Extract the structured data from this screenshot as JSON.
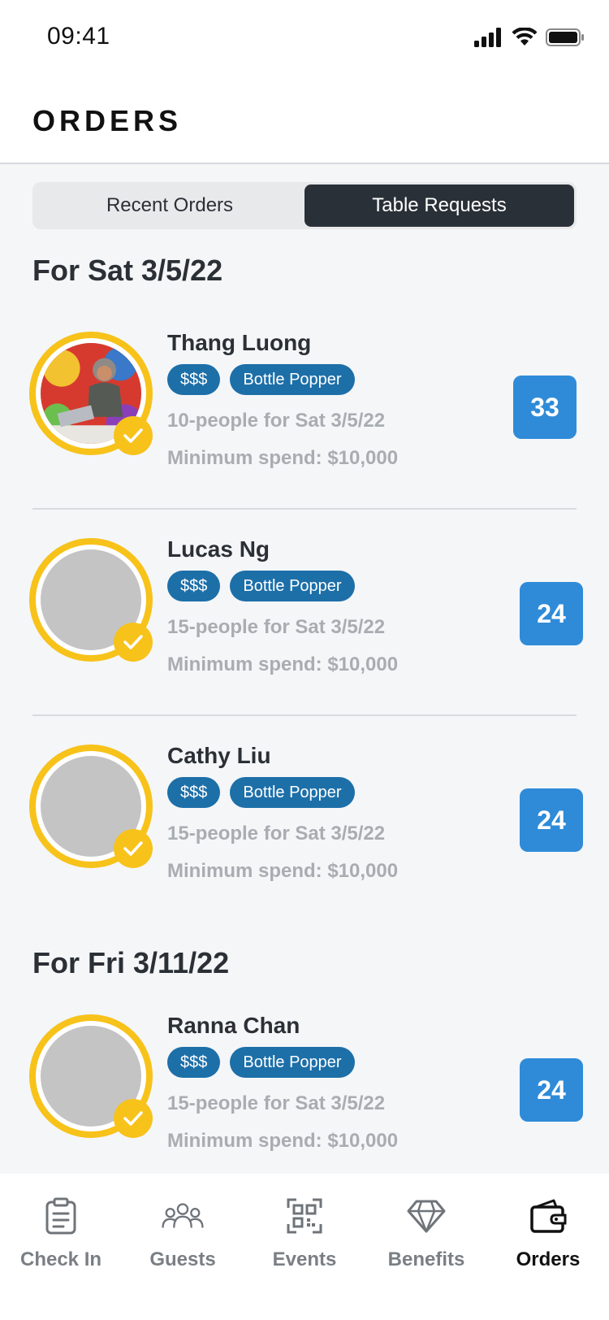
{
  "status_bar": {
    "time": "09:41"
  },
  "header": {
    "title": "ORDERS"
  },
  "segments": [
    {
      "label": "Recent Orders",
      "active": false
    },
    {
      "label": "Table Requests",
      "active": true
    }
  ],
  "sections": [
    {
      "title": "For Sat 3/5/22",
      "orders": [
        {
          "name": "Thang Luong",
          "tags": [
            "$$$",
            "Bottle Popper"
          ],
          "people": "10-people for Sat 3/5/22",
          "spend": "Minimum spend: $10,000",
          "count": "33",
          "has_photo": true
        },
        {
          "name": "Lucas Ng",
          "tags": [
            "$$$",
            "Bottle Popper"
          ],
          "people": "15-people for Sat 3/5/22",
          "spend": "Minimum spend: $10,000",
          "count": "24",
          "has_photo": false
        },
        {
          "name": "Cathy Liu",
          "tags": [
            "$$$",
            "Bottle Popper"
          ],
          "people": "15-people for Sat 3/5/22",
          "spend": "Minimum spend: $10,000",
          "count": "24",
          "has_photo": false
        }
      ]
    },
    {
      "title": "For Fri 3/11/22",
      "orders": [
        {
          "name": "Ranna Chan",
          "tags": [
            "$$$",
            "Bottle Popper"
          ],
          "people": "15-people for Sat 3/5/22",
          "spend": "Minimum spend: $10,000",
          "count": "24",
          "has_photo": false
        }
      ]
    }
  ],
  "tabs": [
    {
      "label": "Check In",
      "icon": "clipboard-icon",
      "active": false
    },
    {
      "label": "Guests",
      "icon": "people-icon",
      "active": false
    },
    {
      "label": "Events",
      "icon": "qr-code-icon",
      "active": false
    },
    {
      "label": "Benefits",
      "icon": "diamond-icon",
      "active": false
    },
    {
      "label": "Orders",
      "icon": "wallet-icon",
      "active": true
    }
  ],
  "colors": {
    "accent_yellow": "#f7c21a",
    "tag_blue": "#1d6fa8",
    "count_blue": "#2f8bd8",
    "segment_active": "#2a3037"
  }
}
